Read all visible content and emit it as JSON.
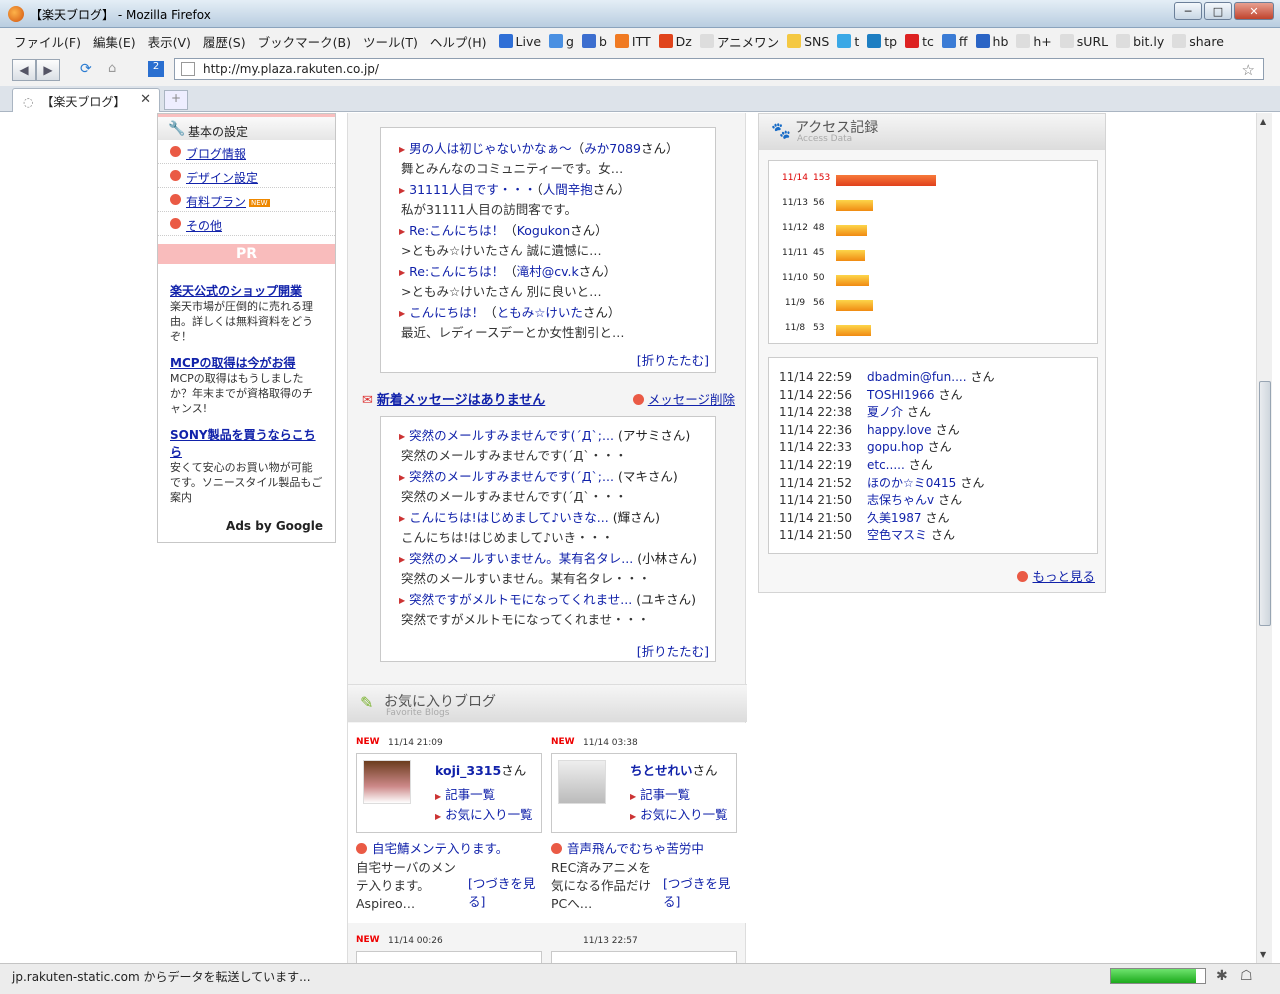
{
  "window": {
    "title": "【楽天ブログ】 - Mozilla Firefox",
    "buttons": [
      "─",
      "□",
      "✕"
    ]
  },
  "menubar": {
    "items": [
      "ファイル(F)",
      "編集(E)",
      "表示(V)",
      "履歴(S)",
      "ブックマーク(B)",
      "ツール(T)",
      "ヘルプ(H)"
    ],
    "bookmarks": [
      {
        "label": "Live",
        "color": "#2f6fd6"
      },
      {
        "label": "g",
        "color": "#4a90e2"
      },
      {
        "label": "b",
        "color": "#3c6ecf"
      },
      {
        "label": "ITT",
        "color": "#f07a22"
      },
      {
        "label": "Dz",
        "color": "#e0441c"
      },
      {
        "label": "アニメワン",
        "color": "#dddddd"
      },
      {
        "label": "SNS",
        "color": "#f4c842"
      },
      {
        "label": "t",
        "color": "#3aa8e6"
      },
      {
        "label": "tp",
        "color": "#1d7ec2"
      },
      {
        "label": "tc",
        "color": "#d22"
      },
      {
        "label": "ff",
        "color": "#3a7bd5"
      },
      {
        "label": "hb",
        "color": "#2a64c5"
      },
      {
        "label": "h+",
        "color": "#dddddd"
      },
      {
        "label": "sURL",
        "color": "#dddddd"
      },
      {
        "label": "bit.ly",
        "color": "#dddddd"
      },
      {
        "label": "share",
        "color": "#dddddd"
      }
    ]
  },
  "navbar": {
    "url": "http://my.plaza.rakuten.co.jp/"
  },
  "tab": {
    "title": "【楽天ブログ】",
    "close": "✕",
    "new": "+"
  },
  "status": {
    "text": "jp.rakuten-static.com からデータを転送しています...",
    "progress": 0.9
  },
  "left": {
    "settings_title": "基本の設定",
    "menu": [
      "ブログ情報",
      "デザイン設定",
      "有料プラン",
      "その他"
    ],
    "new_badge": "NEW",
    "pr": "PR",
    "ads": [
      {
        "title": "楽天公式のショップ開業",
        "desc": "楽天市場が圧倒的に売れる理由。詳しくは無料資料をどうぞ！"
      },
      {
        "title": "MCPの取得は今がお得",
        "desc": "MCPの取得はもうしましたか？年末までが資格取得のチャンス!"
      },
      {
        "title": "SONY製品を買うならこちら",
        "desc": "安くて安心のお買い物が可能です。ソニースタイル製品もご案内"
      }
    ],
    "ads_by": "Ads by Google"
  },
  "comments": {
    "items": [
      {
        "title": "男の人は初じゃないかなぁ〜",
        "author": "みか7089",
        "sub": "舞とみんなのコミュニティーです。女…"
      },
      {
        "title": "31111人目です・・・",
        "author": "人間辛抱",
        "sub": "私が31111人目の訪問客です。"
      },
      {
        "title": "Re:こんにちは！",
        "author": "Kogukon",
        "sub": ">ともみ☆けいたさん 誠に遺憾に…"
      },
      {
        "title": "Re:こんにちは！",
        "author": "滝村@cv.k",
        "sub": ">ともみ☆けいたさん 別に良いと…"
      },
      {
        "title": "こんにちは！",
        "author": "ともみ☆けいた",
        "sub": "最近、レディースデーとか女性割引と…"
      }
    ],
    "fold": "[折りたたむ]",
    "san": "さん"
  },
  "messages": {
    "title": "新着メッセージはありません",
    "delete": "メッセージ削除",
    "items": [
      {
        "title": "突然のメールすみませんです(´Д`;...",
        "author": "(アサミさん)",
        "sub": "突然のメールすみませんです(´Д`・・・"
      },
      {
        "title": "突然のメールすみませんです(´Д`;...",
        "author": "(マキさん)",
        "sub": "突然のメールすみませんです(´Д`・・・"
      },
      {
        "title": "こんにちは!はじめまして♪いきな...",
        "author": "(輝さん)",
        "sub": "こんにちは!はじめまして♪いき・・・"
      },
      {
        "title": "突然のメールすいません。某有名タレ...",
        "author": "(小林さん)",
        "sub": "突然のメールすいません。某有名タレ・・・"
      },
      {
        "title": "突然ですがメルトモになってくれませ...",
        "author": "(ユキさん)",
        "sub": "突然ですがメルトモになってくれませ・・・"
      }
    ],
    "fold": "[折りたたむ]"
  },
  "favorites": {
    "title": "お気に入りブログ",
    "subtitle": "Favorite Blogs",
    "blogs": [
      {
        "new": "NEW",
        "time": "11/14 21:09",
        "user": "koji_3315",
        "links": [
          "記事一覧",
          "お気に入り一覧"
        ],
        "post": "自宅鯖メンテ入ります。",
        "excerpt": "自宅サーバのメンテ入ります。Aspireo…",
        "more": "[つづきを見る]"
      },
      {
        "new": "NEW",
        "time": "11/14 03:38",
        "user": "ちとせれい",
        "links": [
          "記事一覧",
          "お気に入り一覧"
        ],
        "post": "音声飛んでむちゃ苦労中",
        "excerpt": "REC済みアニメを気になる作品だけPCへ…",
        "more": "[つづきを見る]"
      }
    ],
    "next": [
      {
        "new": "NEW",
        "time": "11/14 00:26"
      },
      {
        "new": "",
        "time": "11/13 22:57"
      }
    ]
  },
  "access": {
    "title": "アクセス記録",
    "subtitle": "Access Data",
    "days": [
      {
        "date": "11/14",
        "count": 153
      },
      {
        "date": "11/13",
        "count": 56
      },
      {
        "date": "11/12",
        "count": 48
      },
      {
        "date": "11/11",
        "count": 45
      },
      {
        "date": "11/10",
        "count": 50
      },
      {
        "date": "11/9",
        "count": 56
      },
      {
        "date": "11/8",
        "count": 53
      }
    ],
    "visitors": [
      {
        "time": "11/14 22:59",
        "name": "dbadmin@fun...."
      },
      {
        "time": "11/14 22:56",
        "name": "TOSHI1966"
      },
      {
        "time": "11/14 22:38",
        "name": "夏ノ介"
      },
      {
        "time": "11/14 22:36",
        "name": "happy.love"
      },
      {
        "time": "11/14 22:33",
        "name": "gopu.hop"
      },
      {
        "time": "11/14 22:19",
        "name": "etc....."
      },
      {
        "time": "11/14 21:52",
        "name": "ほのか☆ミ0415"
      },
      {
        "time": "11/14 21:50",
        "name": "志保ちゃんv"
      },
      {
        "time": "11/14 21:50",
        "name": "久美1987"
      },
      {
        "time": "11/14 21:50",
        "name": "空色マスミ"
      }
    ],
    "san": "さん",
    "more": "もっと見る"
  }
}
